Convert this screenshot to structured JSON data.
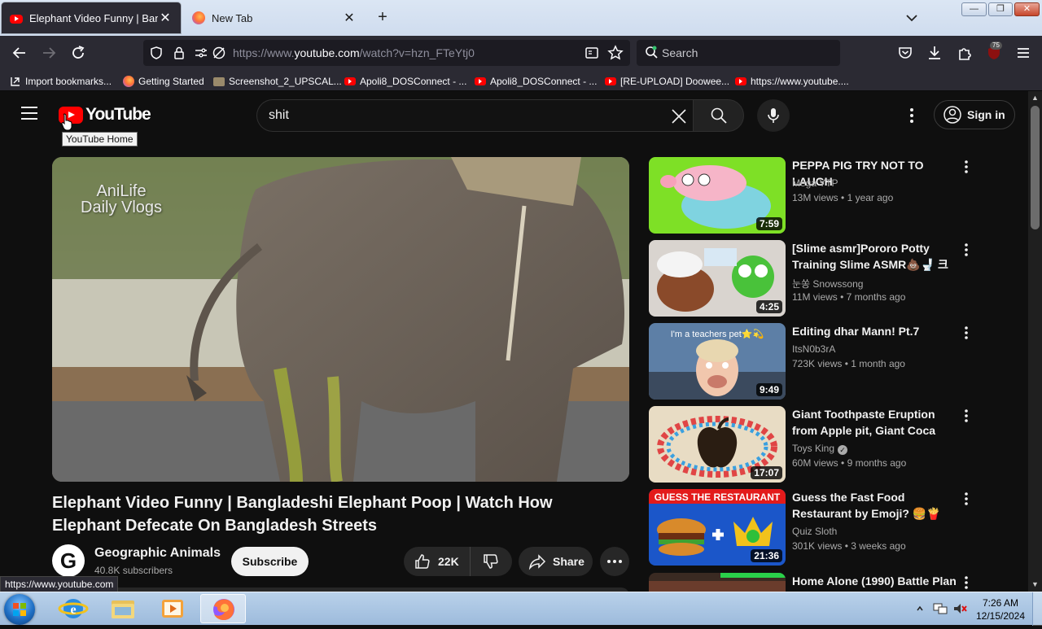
{
  "browser": {
    "tabs": [
      {
        "label": "Elephant Video Funny | Banglad",
        "favicon": "youtube-favicon",
        "active": true
      },
      {
        "label": "New Tab",
        "favicon": "firefox-favicon",
        "active": false
      }
    ],
    "url_prefix": "https://www.",
    "url_domain": "youtube.com",
    "url_path": "/watch?v=hzn_FTeYtj0",
    "search_placeholder": "Search",
    "extension_badge": "75",
    "bookmarks": [
      {
        "label": "Import bookmarks...",
        "icon": "import-icon"
      },
      {
        "label": "Getting Started",
        "icon": "firefox-icon"
      },
      {
        "label": "Screenshot_2_UPSCAL...",
        "icon": "folder-icon"
      },
      {
        "label": "Apoli8_DOSConnect - ...",
        "icon": "youtube-icon"
      },
      {
        "label": "Apoli8_DOSConnect - ...",
        "icon": "youtube-icon"
      },
      {
        "label": "[RE-UPLOAD] Doowee...",
        "icon": "youtube-icon"
      },
      {
        "label": "https://www.youtube....",
        "icon": "youtube-icon"
      }
    ],
    "status_url": "https://www.youtube.com"
  },
  "youtube": {
    "logo_text": "YouTube",
    "tooltip": "YouTube Home",
    "search_value": "shit",
    "sign_in": "Sign in",
    "video": {
      "watermark_line1": "AniLife",
      "watermark_line2": "Daily Vlogs",
      "title": "Elephant Video Funny | Bangladeshi Elephant Poop | Watch How Elephant Defecate On Bangladesh Streets",
      "channel_initial": "G",
      "channel": "Geographic Animals",
      "subscribers": "40.8K subscribers",
      "subscribe": "Subscribe",
      "likes": "22K",
      "share": "Share"
    },
    "recommendations": [
      {
        "title": "PEPPA PIG TRY NOT TO LAUGH",
        "channel": "Mega YTP",
        "views": "13M views",
        "age": "1 year ago",
        "duration": "7:59",
        "verified": false
      },
      {
        "title": "[Slime asmr]Pororo Potty Training Slime ASMR💩🚽 크롱...",
        "channel": "눈쏭 Snowssong",
        "views": "11M views",
        "age": "7 months ago",
        "duration": "4:25",
        "verified": false
      },
      {
        "title": "Editing dhar Mann! Pt.7",
        "channel": "ItsN0b3rA",
        "views": "723K views",
        "age": "1 month ago",
        "duration": "9:49",
        "verified": false,
        "thumb_text": "I'm a teachers pet⭐💫"
      },
      {
        "title": "Giant Toothpaste Eruption from Apple pit, Giant Coca Cola &...",
        "channel": "Toys King",
        "views": "60M views",
        "age": "9 months ago",
        "duration": "17:07",
        "verified": true
      },
      {
        "title": "Guess the Fast Food Restaurant by Emoji? 🍔🍟 Quiz Sloth",
        "channel": "Quiz Sloth",
        "views": "301K views",
        "age": "3 weeks ago",
        "duration": "21:36",
        "verified": false,
        "thumb_text": "GUESS THE RESTAURANT"
      },
      {
        "title": "Home Alone (1990) Battle Plan",
        "channel": "",
        "views": "",
        "age": "",
        "duration": "",
        "verified": false
      }
    ]
  },
  "taskbar": {
    "time": "7:26 AM",
    "date": "12/15/2024"
  }
}
